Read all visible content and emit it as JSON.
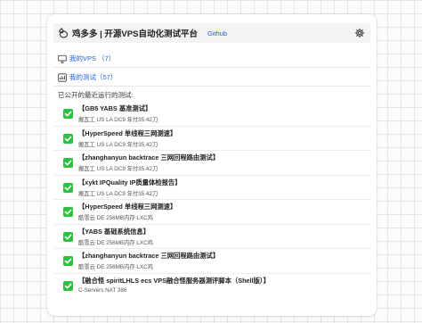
{
  "header": {
    "title": "鸡多多 | 开源VPS自动化测试平台",
    "github_label": "Github",
    "logo_icon": "chicken-logo-icon",
    "settings_icon": "gear-icon"
  },
  "nav": {
    "my_vps": "我的VPS （7）",
    "my_tests": "我的测试（57）"
  },
  "section_label": "已公开的最近运行的测试:",
  "colors": {
    "accent": "#2563d6",
    "check": "#2fbf43"
  },
  "tests": [
    {
      "title": "【GB5 YABS 基准测试】",
      "subtitle": "搬瓦工 US LA DC9 年付35.42刀"
    },
    {
      "title": "【HyperSpeed 单线程三网测速】",
      "subtitle": "搬瓦工 US LA DC9 年付35.42刀"
    },
    {
      "title": "【zhanghanyun backtrace 三网回程路由测试】",
      "subtitle": "搬瓦工 US LA DC9 年付35.42刀"
    },
    {
      "title": "【xykt IPQuality IP质量体检报告】",
      "subtitle": "搬瓦工 US LA DC9 年付35.42刀"
    },
    {
      "title": "【HyperSpeed 单线程三网测速】",
      "subtitle": "酷雪云 DE 256MB内存 LXC鸡"
    },
    {
      "title": "【YABS 基础系统信息】",
      "subtitle": "酷雪云 DE 256MB内存 LXC鸡"
    },
    {
      "title": "【zhanghanyun backtrace 三网回程路由测试】",
      "subtitle": "酷雪云 DE 256MB内存 LXC鸡"
    },
    {
      "title": "【融合怪 spiritLHLS ecs VPS融合怪服务器测评脚本（Shell版）】",
      "subtitle": "C-Servers NAT 386"
    }
  ]
}
